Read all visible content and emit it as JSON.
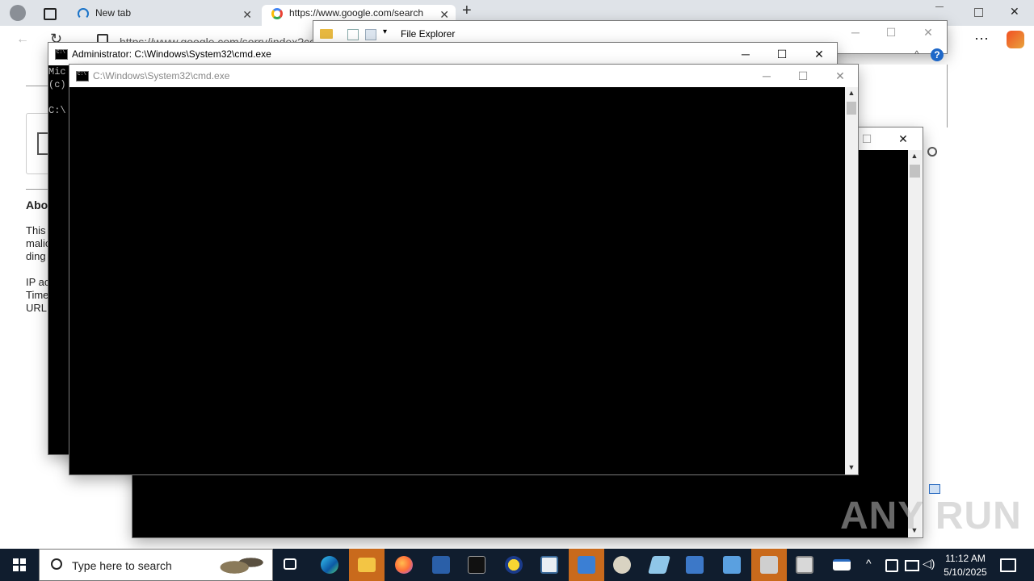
{
  "browser": {
    "tabs": [
      {
        "label": "New tab",
        "close": "✕"
      },
      {
        "label": "https://www.google.com/search",
        "close": "✕"
      }
    ],
    "new_tab": "+",
    "address": "https://www.google.com/sorry/index?co",
    "page_fragments": [
      "Abou",
      "This",
      "malic",
      "ding",
      "IP ac",
      "Time",
      "URL:"
    ],
    "menu": "⋯"
  },
  "file_explorer": {
    "title": "File Explorer",
    "controls": {
      "minimize": "─",
      "maximize": "☐",
      "close": "✕"
    },
    "help": "?"
  },
  "cmd_admin": {
    "title": "Administrator: C:\\Windows\\System32\\cmd.exe",
    "lines": [
      "Mic",
      "(c)",
      "",
      "C:\\"
    ],
    "controls": {
      "minimize": "─",
      "maximize": "☐",
      "close": "✕"
    }
  },
  "cmd_front": {
    "title": "C:\\Windows\\System32\\cmd.exe",
    "controls": {
      "minimize": "─",
      "maximize": "☐",
      "close": "✕"
    }
  },
  "cmd_back": {
    "controls": {
      "maximize": "☐",
      "close": "✕"
    }
  },
  "taskbar": {
    "search_placeholder": "Type here to search",
    "time": "11:12 AM",
    "date": "5/10/2025",
    "icons": [
      "task-view-icon",
      "edge-icon",
      "file-explorer-icon",
      "firefox-icon",
      "powershell-icon",
      "cmd-icon",
      "tool-icon",
      "app-window-icon",
      "network-app-icon",
      "paint-icon",
      "notepad-icon",
      "computer-icon",
      "control-panel-icon",
      "printer-icon",
      "archive-icon"
    ]
  },
  "watermark": "ANY RUN",
  "colors": {
    "taskbar": "#101d2e",
    "cmd_bg": "#000000",
    "accent": "#c96a1c"
  }
}
